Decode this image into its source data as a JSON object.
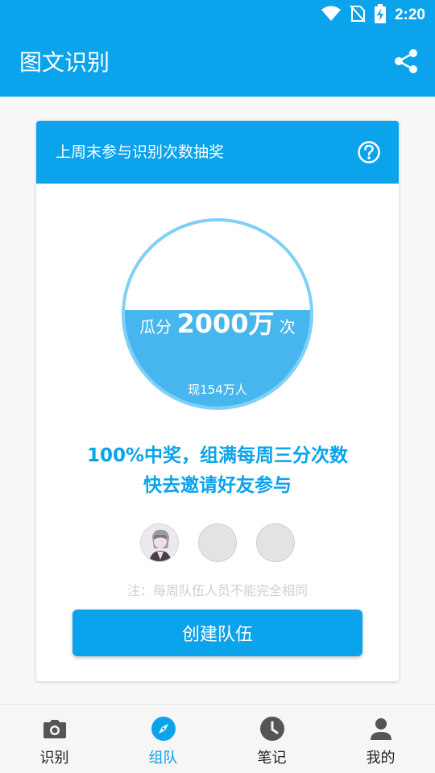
{
  "status_bar": {
    "time": "2:20"
  },
  "app_bar": {
    "title": "图文识别"
  },
  "card": {
    "title": "上周末参与识别次数抽奖",
    "prize_prefix": "瓜分",
    "prize_amount": "2000万",
    "prize_suffix": "次",
    "current_participants": "现154万人",
    "promo_line1": "100%中奖，组满每周三分次数",
    "promo_line2": "快去邀请好友参与",
    "note": "注：每周队伍人员不能完全相同",
    "create_button": "创建队伍"
  },
  "bottom_nav": {
    "items": [
      {
        "label": "识别",
        "icon": "camera-icon"
      },
      {
        "label": "组队",
        "icon": "compass-icon",
        "active": true
      },
      {
        "label": "笔记",
        "icon": "clock-icon"
      },
      {
        "label": "我的",
        "icon": "person-icon"
      }
    ]
  },
  "colors": {
    "primary": "#0aa3ec",
    "water": "#48b6ee",
    "ring": "#7fd0f5",
    "note": "#cfcfcf"
  }
}
